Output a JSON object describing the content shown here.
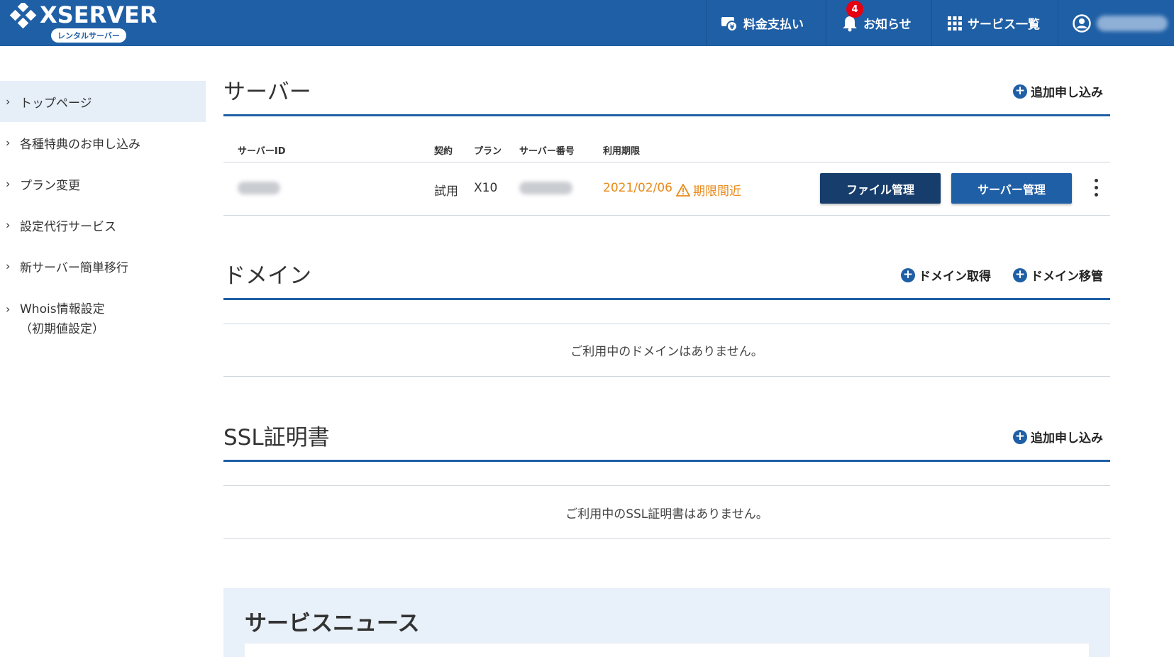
{
  "header": {
    "logo_text": "XSERVER",
    "logo_sub": "レンタルサーバー",
    "nav": {
      "payment": "料金支払い",
      "news": "お知らせ",
      "news_badge": "4",
      "services": "サービス一覧"
    }
  },
  "sidebar": {
    "items": [
      {
        "label": "トップページ"
      },
      {
        "label": "各種特典のお申し込み"
      },
      {
        "label": "プラン変更"
      },
      {
        "label": "設定代行サービス"
      },
      {
        "label": "新サーバー簡単移行"
      },
      {
        "label_line1": "Whois情報設定",
        "label_line2": "（初期値設定）"
      }
    ]
  },
  "server": {
    "title": "サーバー",
    "add_link": "追加申し込み",
    "columns": [
      "サーバーID",
      "契約",
      "プラン",
      "サーバー番号",
      "利用期限"
    ],
    "row": {
      "contract": "試用",
      "plan": "X10",
      "expiry": "2021/02/06",
      "expiry_warning": "期限間近"
    },
    "file_button": "ファイル管理",
    "server_button": "サーバー管理"
  },
  "domain": {
    "title": "ドメイン",
    "acquire_link": "ドメイン取得",
    "transfer_link": "ドメイン移管",
    "empty": "ご利用中のドメインはありません。"
  },
  "ssl": {
    "title": "SSL証明書",
    "add_link": "追加申し込み",
    "empty": "ご利用中のSSL証明書はありません。"
  },
  "news": {
    "title": "サービスニュース"
  },
  "colors": {
    "brand": "#1f5fa6",
    "dark_button": "#163d6b",
    "warning": "#e88a1a",
    "badge": "#e60012",
    "active_bg": "#e6eef8"
  }
}
